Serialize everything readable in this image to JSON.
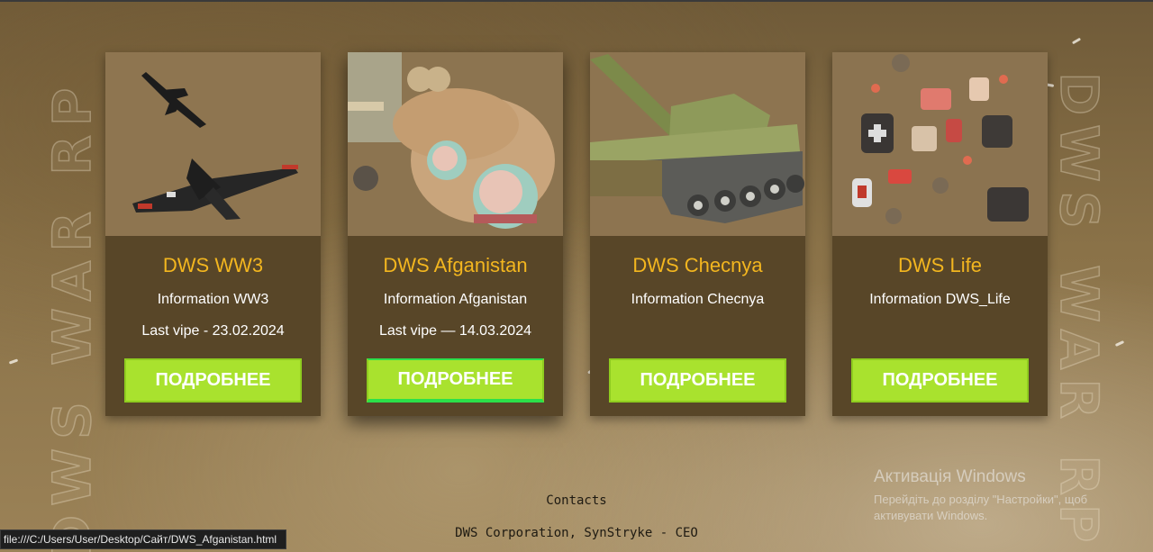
{
  "watermark": {
    "text": "DWS WAR RP"
  },
  "cards": [
    {
      "title": "DWS WW3",
      "info": "Information WW3",
      "wipe": "Last vipe - 23.02.2024",
      "button": "ПОДРОБНЕЕ",
      "image": "jets-illustration"
    },
    {
      "title": "DWS Afganistan",
      "info": "Information Afganistan",
      "wipe": "Last vipe — 14.03.2024",
      "button": "ПОДРОБНЕЕ",
      "image": "helicopter-illustration"
    },
    {
      "title": "DWS Checnya",
      "info": "Information Checnya",
      "wipe": "",
      "button": "ПОДРОБНЕЕ",
      "image": "tank-illustration"
    },
    {
      "title": "DWS Life",
      "info": "Information DWS_Life",
      "wipe": "",
      "button": "ПОДРОБНЕЕ",
      "image": "medkits-illustration"
    }
  ],
  "footer": {
    "contacts": "Contacts",
    "corp": "DWS Corporation, SynStryke - CEO"
  },
  "activation": {
    "title": "Активація Windows",
    "line1": "Перейдіть до розділу \"Настройки\", щоб",
    "line2": "активувати Windows."
  },
  "status_url": "file:///C:/Users/User/Desktop/Сайт/DWS_Afganistan.html",
  "colors": {
    "accent": "#a9e22e",
    "title": "#f3b61f",
    "card_bg": "#584628"
  }
}
